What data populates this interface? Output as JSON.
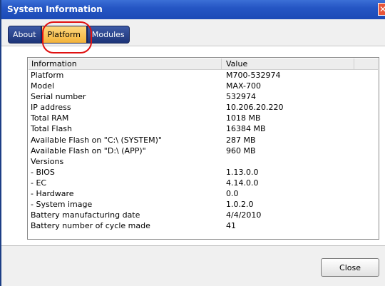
{
  "window": {
    "title": "System Information"
  },
  "tabs": [
    {
      "label": "About"
    },
    {
      "label": "Platform"
    },
    {
      "label": "Modules"
    }
  ],
  "table": {
    "headers": {
      "information": "Information",
      "value": "Value"
    },
    "rows": [
      {
        "label": "Platform",
        "value": "M700-532974"
      },
      {
        "label": "Model",
        "value": "MAX-700"
      },
      {
        "label": "Serial number",
        "value": "532974"
      },
      {
        "label": "IP address",
        "value": "10.206.20.220"
      },
      {
        "label": "Total RAM",
        "value": "1018 MB"
      },
      {
        "label": "Total Flash",
        "value": "16384 MB"
      },
      {
        "label": "Available Flash on \"C:\\ (SYSTEM)\"",
        "value": "287 MB"
      },
      {
        "label": "Available Flash on \"D:\\ (APP)\"",
        "value": "960 MB"
      },
      {
        "label": "Versions",
        "value": ""
      },
      {
        "label": "- BIOS",
        "value": "1.13.0.0"
      },
      {
        "label": "- EC",
        "value": "4.14.0.0"
      },
      {
        "label": "- Hardware",
        "value": "0.0"
      },
      {
        "label": "- System image",
        "value": "1.0.2.0"
      },
      {
        "label": "Battery manufacturing date",
        "value": "4/4/2010"
      },
      {
        "label": "Battery number of cycle made",
        "value": "41"
      }
    ]
  },
  "buttons": {
    "close": "Close"
  },
  "colors": {
    "titlebar": "#2556c4",
    "tab": "#1d3478",
    "active_tab": "#f3b33a",
    "highlight": "#e01010"
  }
}
